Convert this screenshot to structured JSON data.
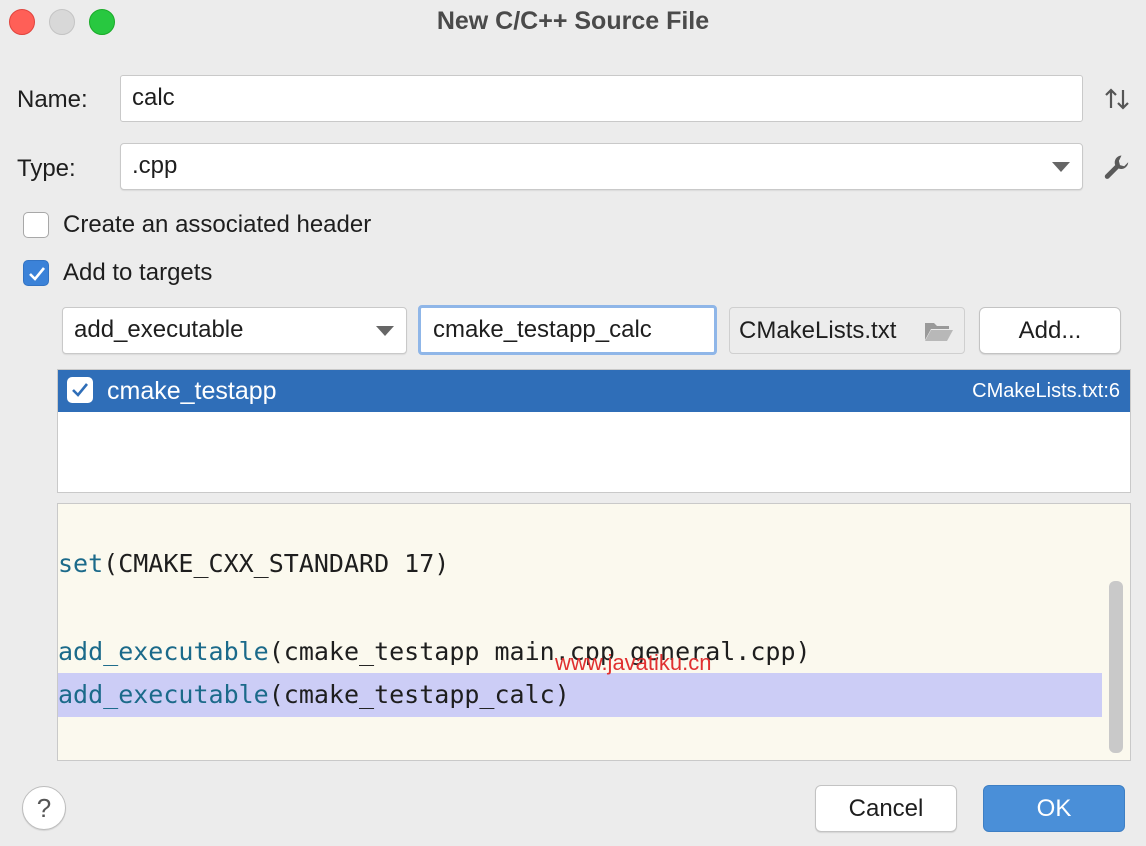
{
  "window": {
    "title": "New C/C++ Source File"
  },
  "form": {
    "name_label": "Name:",
    "name_value": "calc",
    "type_label": "Type:",
    "type_value": ".cpp",
    "create_header_label": "Create an associated header",
    "create_header_checked": false,
    "add_targets_label": "Add to targets",
    "add_targets_checked": true
  },
  "targets_toolbar": {
    "command_value": "add_executable",
    "target_name_value": "cmake_testapp_calc",
    "cmake_file_value": "CMakeLists.txt",
    "add_button": "Add..."
  },
  "targets_list": [
    {
      "name": "cmake_testapp",
      "location": "CMakeLists.txt:6",
      "checked": true,
      "selected": true
    }
  ],
  "code_preview": {
    "lines": [
      {
        "fn": "set",
        "args": "(CMAKE_CXX_STANDARD 17)",
        "highlight": false
      },
      {
        "fn": "add_executable",
        "args": "(cmake_testapp main.cpp general.cpp)",
        "highlight": false
      },
      {
        "fn": "add_executable",
        "args": "(cmake_testapp_calc)",
        "highlight": true
      }
    ],
    "watermark": "www.javatiku.cn"
  },
  "footer": {
    "help_label": "?",
    "cancel_button": "Cancel",
    "ok_button": "OK"
  },
  "colors": {
    "selection": "#2f6eb8",
    "primary_button": "#4a8fd8",
    "highlight_line": "#cccdf6",
    "code_background": "#fbf9ee",
    "keyword": "#1b6a8a"
  },
  "icons": {
    "sort": "sort-icon",
    "settings": "wrench-icon",
    "folder": "folder-open-icon"
  }
}
